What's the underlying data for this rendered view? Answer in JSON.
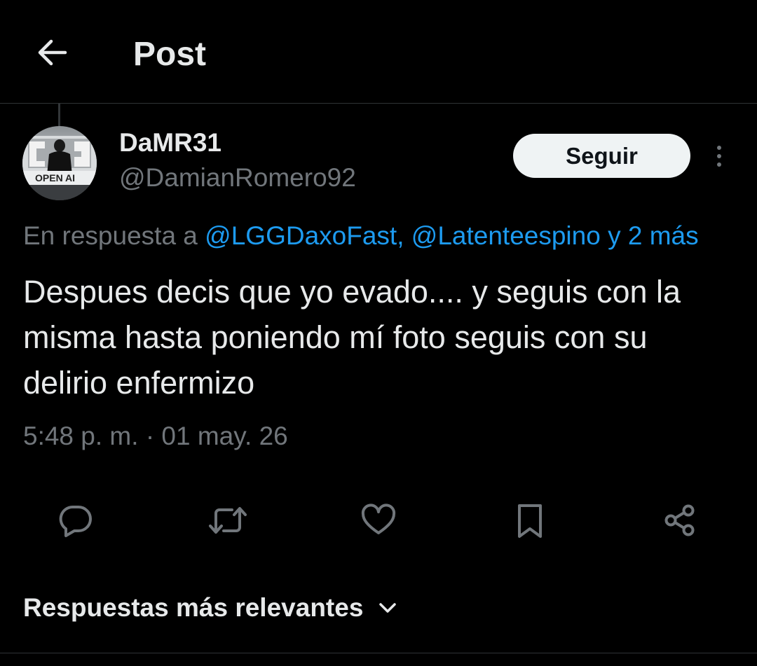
{
  "header": {
    "title": "Post",
    "back_icon": "arrow-left-icon"
  },
  "tweet": {
    "author": {
      "display_name": "DaMR31",
      "handle": "@DamianRomero92",
      "avatar_text": "OPEN AI"
    },
    "follow_label": "Seguir",
    "more_icon": "more-vertical-icon",
    "reply_to": {
      "prefix": "En respuesta a",
      "mentions": [
        "@LGGDaxoFast,",
        "@Latenteespino"
      ],
      "suffix": "y 2 más"
    },
    "text": "Despues decis que yo evado.... y seguis con la misma hasta poniendo mí foto seguis con su delirio enfermizo",
    "time": "5:48 p. m.",
    "separator": "·",
    "date": "01 may. 26"
  },
  "actions": [
    {
      "name": "reply",
      "icon": "comment-icon"
    },
    {
      "name": "repost",
      "icon": "retweet-icon"
    },
    {
      "name": "like",
      "icon": "heart-icon"
    },
    {
      "name": "bookmark",
      "icon": "bookmark-icon"
    },
    {
      "name": "share",
      "icon": "share-icon"
    }
  ],
  "replies_sort": {
    "label": "Respuestas más relevantes",
    "icon": "chevron-down-icon"
  },
  "colors": {
    "background": "#000000",
    "text_primary": "#e7e9ea",
    "text_secondary": "#71767b",
    "link": "#1d9bf0",
    "button_bg": "#eff3f4",
    "divider": "#2f3336"
  }
}
